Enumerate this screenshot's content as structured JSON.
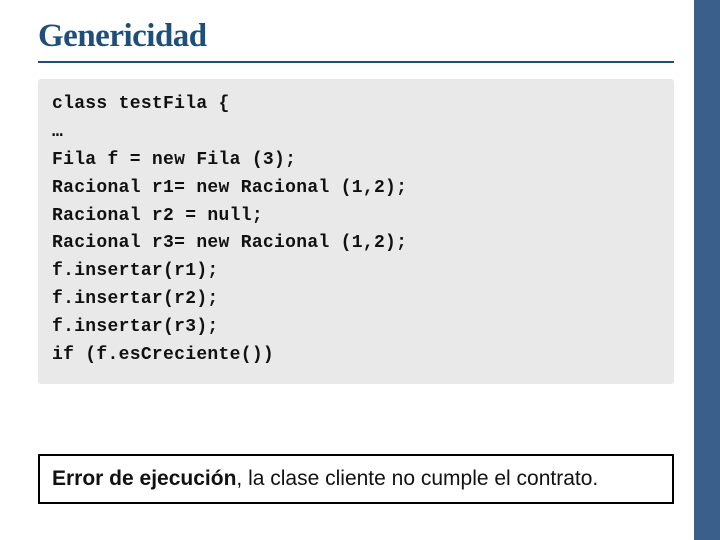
{
  "title": "Genericidad",
  "code": {
    "l0": "class testFila {",
    "l1": "…",
    "l2": "Fila f = new Fila (3);",
    "l3": "Racional r1= new Racional (1,2);",
    "l4": "Racional r2 = null;",
    "l5": "Racional r3= new Racional (1,2);",
    "l6": "f.insertar(r1);",
    "l7": "f.insertar(r2);",
    "l8": "f.insertar(r3);",
    "l9": "if (f.esCreciente())"
  },
  "error": {
    "bold": "Error de ejecución",
    "rest": ", la clase cliente no cumple el contrato."
  }
}
